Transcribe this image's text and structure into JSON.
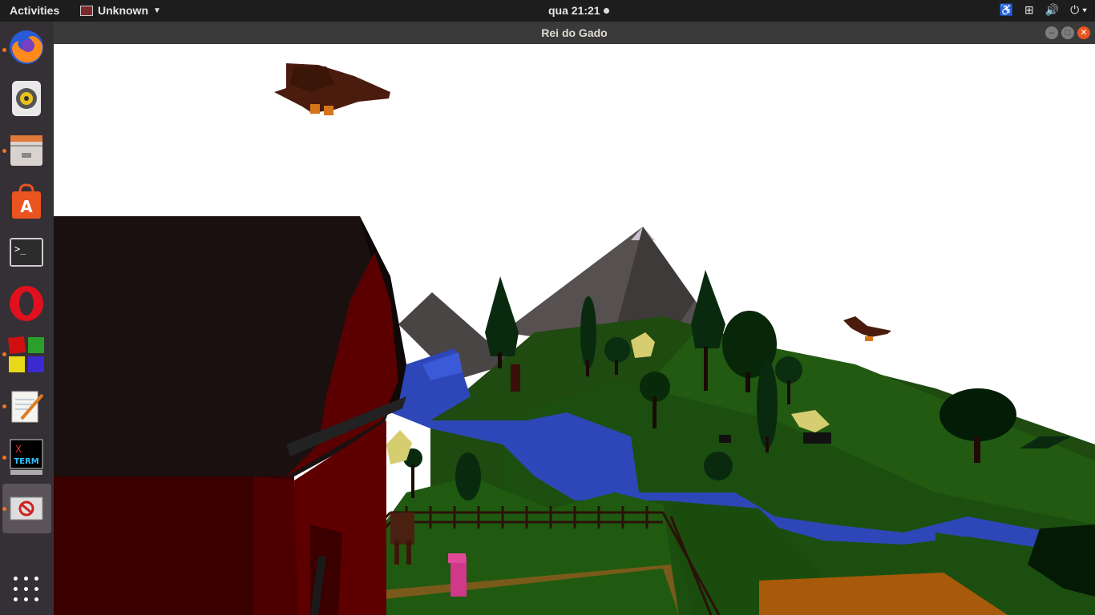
{
  "topbar": {
    "activities_label": "Activities",
    "app_menu_label": "Unknown",
    "clock": "qua 21:21"
  },
  "window": {
    "title": "Rei do Gado"
  },
  "dock": {
    "items": [
      "firefox",
      "rhythmbox",
      "files",
      "ubuntu-software",
      "terminal",
      "opera",
      "color-grid-app",
      "text-editor",
      "xterm",
      "running-game"
    ],
    "xterm_icon_text_x": "X",
    "xterm_icon_text_term": "TERM"
  },
  "colors": {
    "panel": "#1d1d1d",
    "dock": "#353035",
    "titlebar": "#3a3a3a",
    "close": "#e95420",
    "grass": "#1f5a10",
    "river": "#2d47b8",
    "barn_red": "#5a0000",
    "sky": "#ffffff"
  }
}
